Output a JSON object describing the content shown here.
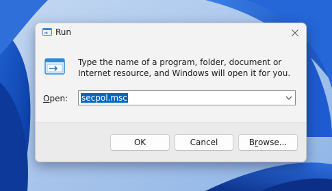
{
  "dialog": {
    "title": "Run",
    "description": "Type the name of a program, folder, document or Internet resource, and Windows will open it for you.",
    "open_label_mnemonic": "O",
    "open_label_rest": "pen:",
    "open_value": "secpol.msc",
    "buttons": {
      "ok": "OK",
      "cancel": "Cancel",
      "browse_pre": "B",
      "browse_mnemonic": "r",
      "browse_post": "owse..."
    }
  },
  "colors": {
    "selection": "#0067c0",
    "dialog_bg": "#f3f3f3",
    "footer_bg": "#ebebeb",
    "wallpaper": "#2a6fd6"
  },
  "icons": [
    "run-app-icon",
    "close-icon",
    "run-program-icon",
    "chevron-down-icon"
  ]
}
